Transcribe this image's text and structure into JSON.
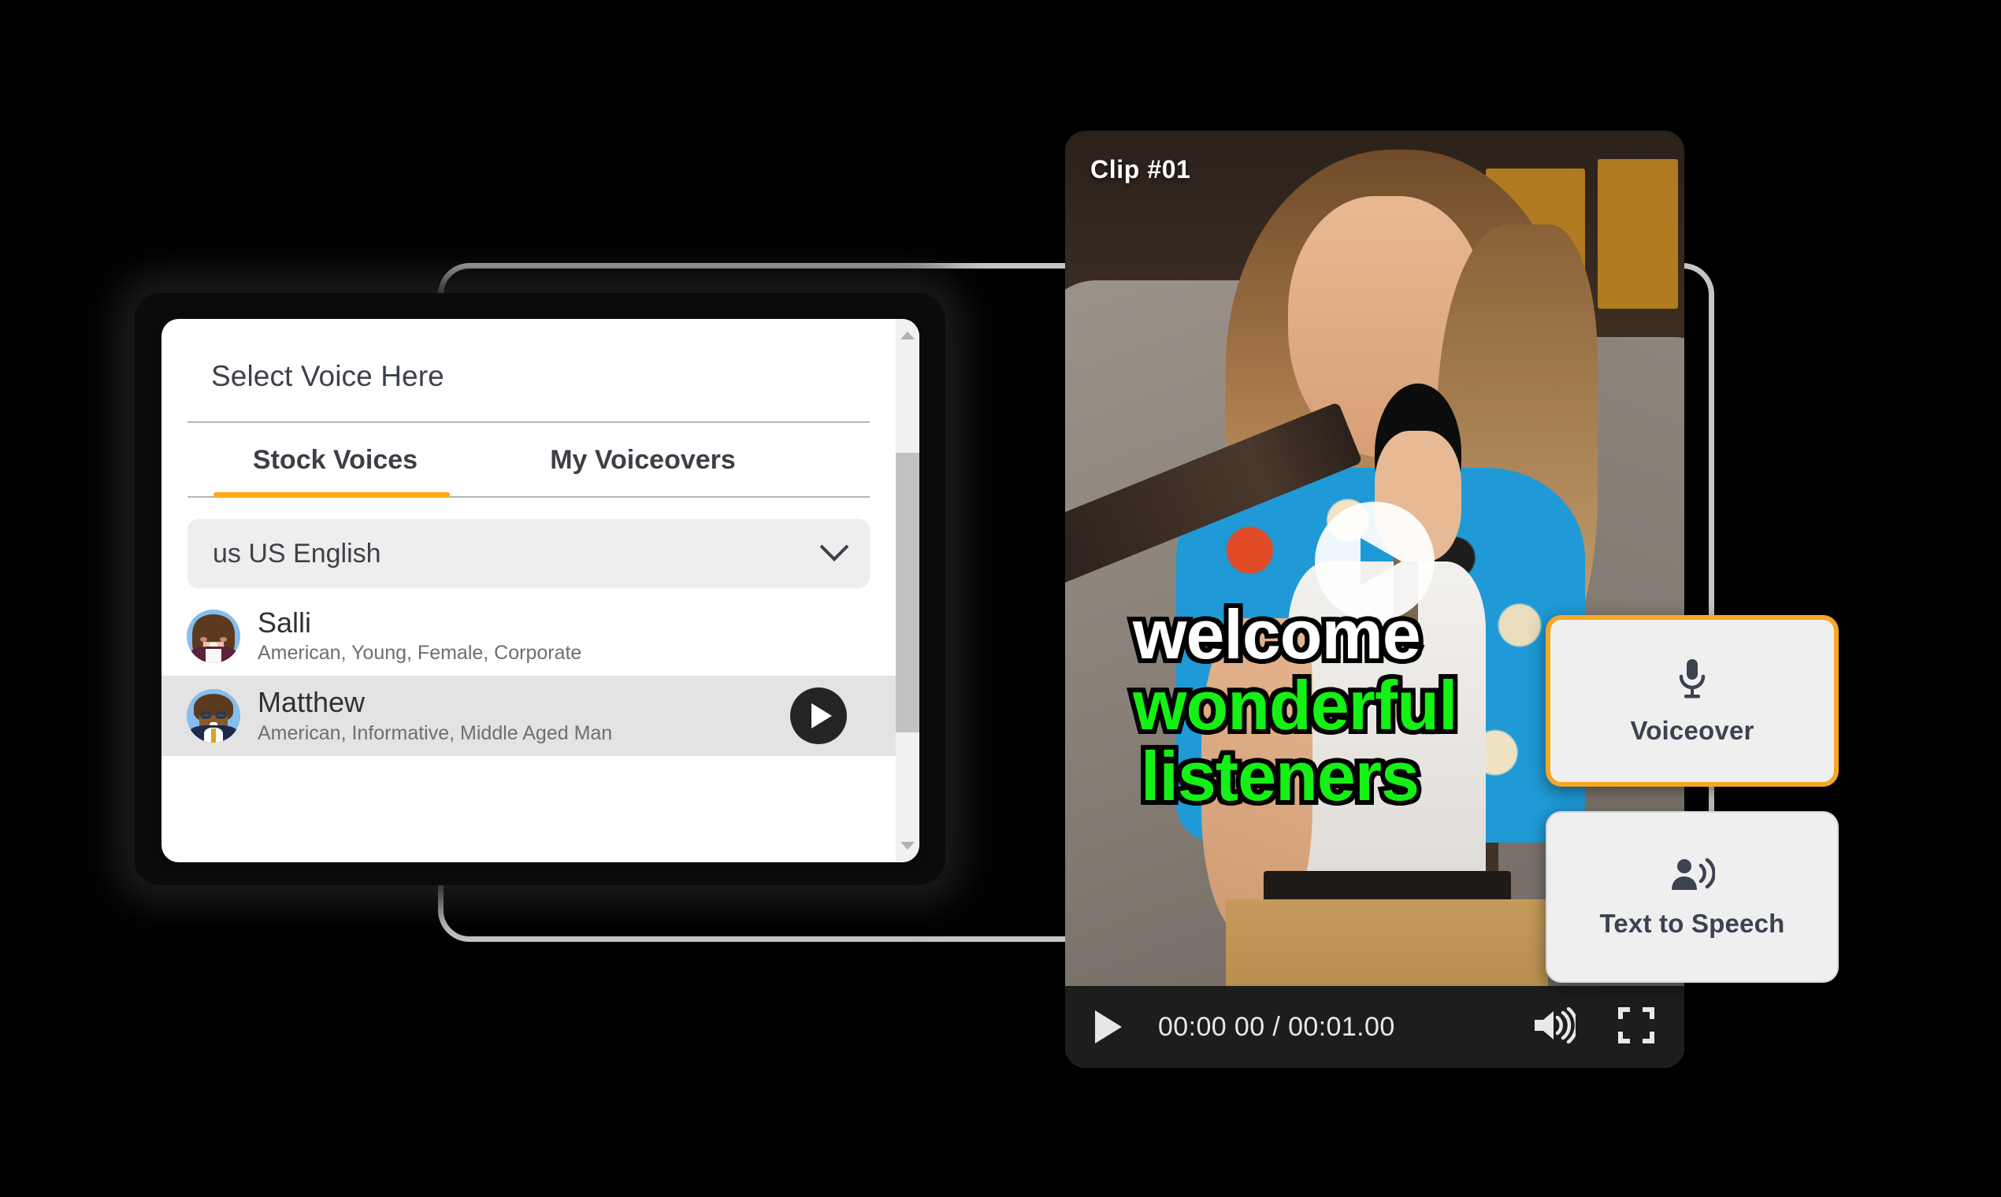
{
  "voice_panel": {
    "title": "Select Voice Here",
    "tabs": [
      {
        "label": "Stock Voices",
        "active": true
      },
      {
        "label": "My Voiceovers",
        "active": false
      }
    ],
    "language_select": {
      "value": "us US English",
      "chevron_icon": "chevron-down-icon"
    },
    "voices": [
      {
        "name": "Salli",
        "description": "American, Young, Female, Corporate",
        "avatar_icon": "avatar-salli",
        "selected": false,
        "has_play": false
      },
      {
        "name": "Matthew",
        "description": "American, Informative, Middle Aged Man",
        "avatar_icon": "avatar-matthew",
        "selected": true,
        "has_play": true,
        "play_icon": "play-icon"
      }
    ],
    "scrollbar": {
      "up_arrow_icon": "scroll-up-arrow-icon",
      "down_arrow_icon": "scroll-down-arrow-icon"
    }
  },
  "player": {
    "clip_badge": "Clip #01",
    "play_overlay_icon": "play-circle-icon",
    "captions": [
      {
        "text": "welcome",
        "color": "#ffffff"
      },
      {
        "text": "wonderful",
        "color": "#15f015"
      },
      {
        "text": "listeners",
        "color": "#15f015"
      }
    ],
    "controls": {
      "play_icon": "play-icon",
      "time": "00:00 00 / 00:01.00",
      "volume_icon": "volume-high-icon",
      "fullscreen_icon": "fullscreen-icon"
    }
  },
  "feature_cards": [
    {
      "label": "Voiceover",
      "icon": "microphone-icon",
      "active": true,
      "border_color": "#f5a623"
    },
    {
      "label": "Text to Speech",
      "icon": "speaking-person-icon",
      "active": false,
      "border_color": "#d6d6d6"
    }
  ],
  "colors": {
    "accent_orange": "#ffa81a",
    "card_border_active": "#f5a623",
    "caption_green": "#15f015",
    "panel_bg": "#ffffff",
    "selected_row": "#e3e3e3"
  }
}
